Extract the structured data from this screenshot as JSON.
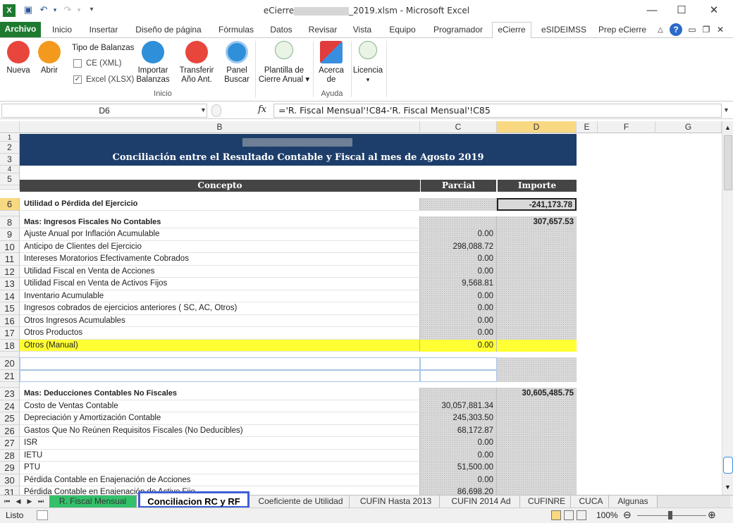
{
  "window": {
    "title_prefix": "eCierre",
    "title_suffix": "_2019.xlsm  -  Microsoft Excel",
    "minimize": "—",
    "maximize": "☐",
    "close": "✕"
  },
  "ribbon_tabs": [
    "Archivo",
    "Inicio",
    "Insertar",
    "Diseño de página",
    "Fórmulas",
    "Datos",
    "Revisar",
    "Vista",
    "Equipo",
    "Programador",
    "eCierre",
    "eSIDEIMSS",
    "Prep eCierre"
  ],
  "ribbon": {
    "nueva": "Nueva",
    "abrir": "Abrir",
    "tipo_balanzas": "Tipo de Balanzas",
    "ce_xml": "CE (XML)",
    "excel_xlsx": "Excel (XLSX)",
    "importar_l1": "Importar",
    "importar_l2": "Balanzas",
    "transferir_l1": "Transferir",
    "transferir_l2": "Año Ant.",
    "panel_l1": "Panel",
    "panel_l2": "Buscar",
    "group_inicio": "Inicio",
    "plantilla_l1": "Plantilla de",
    "plantilla_l2": "Cierre Anual ▾",
    "acerca_l1": "Acerca",
    "acerca_l2": "de",
    "group_ayuda": "Ayuda",
    "licencia": "Licencia",
    "licencia_arrow": "▾"
  },
  "formula_bar": {
    "name_box": "D6",
    "fx": "fx",
    "formula": "='R. Fiscal Mensual'!C84-'R. Fiscal Mensual'!C85"
  },
  "columns": [
    "B",
    "C",
    "D",
    "E",
    "F",
    "G"
  ],
  "sheet": {
    "title": "Conciliación entre el Resultado Contable y Fiscal  al mes de Agosto 2019",
    "header_concepto": "Concepto",
    "header_parcial": "Parcial",
    "header_importe": "Importe",
    "rows": [
      {
        "n": "6",
        "concept": "Utilidad o Pérdida del Ejercicio",
        "parcial": "",
        "importe": "-241,173.78",
        "bold": true
      },
      {
        "n": "8",
        "concept": "Mas: Ingresos Fiscales No Contables",
        "parcial": "",
        "importe": "307,657.53",
        "bold": true
      },
      {
        "n": "9",
        "concept": " Ajuste Anual por Inflación Acumulable",
        "parcial": "0.00",
        "importe": ""
      },
      {
        "n": "10",
        "concept": " Anticipo de Clientes del Ejercicio",
        "parcial": "298,088.72",
        "importe": ""
      },
      {
        "n": "11",
        "concept": " Intereses Moratorios Efectivamente Cobrados",
        "parcial": "0.00",
        "importe": ""
      },
      {
        "n": "12",
        "concept": " Utilidad Fiscal en Venta de Acciones",
        "parcial": "0.00",
        "importe": ""
      },
      {
        "n": "13",
        "concept": " Utilidad Fiscal en Venta de Activos Fijos",
        "parcial": "9,568.81",
        "importe": ""
      },
      {
        "n": "14",
        "concept": " Inventario Acumulable",
        "parcial": "0.00",
        "importe": ""
      },
      {
        "n": "15",
        "concept": "Ingresos cobrados de ejercicios anteriores ( SC, AC, Otros)",
        "parcial": "0.00",
        "importe": ""
      },
      {
        "n": "16",
        "concept": "Otros Ingresos Acumulables",
        "parcial": "0.00",
        "importe": ""
      },
      {
        "n": "17",
        "concept": "Otros Productos",
        "parcial": "0.00",
        "importe": ""
      },
      {
        "n": "18",
        "concept": "Otros (Manual)",
        "parcial": "0.00",
        "importe": ""
      },
      {
        "n": "20",
        "concept": "",
        "parcial": "",
        "importe": ""
      },
      {
        "n": "21",
        "concept": "",
        "parcial": "",
        "importe": ""
      },
      {
        "n": "23",
        "concept": "Mas: Deducciones Contables No Fiscales",
        "parcial": "",
        "importe": "30,605,485.75",
        "bold": true
      },
      {
        "n": "24",
        "concept": " Costo de Ventas Contable",
        "parcial": "30,057,881.34",
        "importe": ""
      },
      {
        "n": "25",
        "concept": " Depreciación y Amortización Contable",
        "parcial": "245,303.50",
        "importe": ""
      },
      {
        "n": "26",
        "concept": " Gastos Que No Reúnen Requisitos Fiscales (No Deducibles)",
        "parcial": "68,172.87",
        "importe": ""
      },
      {
        "n": "27",
        "concept": " ISR",
        "parcial": "0.00",
        "importe": ""
      },
      {
        "n": "28",
        "concept": " IETU",
        "parcial": "0.00",
        "importe": ""
      },
      {
        "n": "29",
        "concept": " PTU",
        "parcial": "51,500.00",
        "importe": ""
      },
      {
        "n": "30",
        "concept": " Pérdida Contable en Enajenación de Acciones",
        "parcial": "0.00",
        "importe": ""
      },
      {
        "n": "31",
        "concept": " Pérdida Contable en Enajenación de Activo Fijo",
        "parcial": "86,698.20",
        "importe": ""
      }
    ]
  },
  "sheet_tabs": [
    "R. Fiscal Mensual",
    "Conciliacion RC y RF",
    "Coeficiente de Utilidad",
    "CUFIN Hasta 2013",
    "CUFIN 2014 Ad",
    "CUFINRE",
    "CUCA",
    "Algunas"
  ],
  "status": {
    "ready": "Listo",
    "zoom": "100%"
  }
}
